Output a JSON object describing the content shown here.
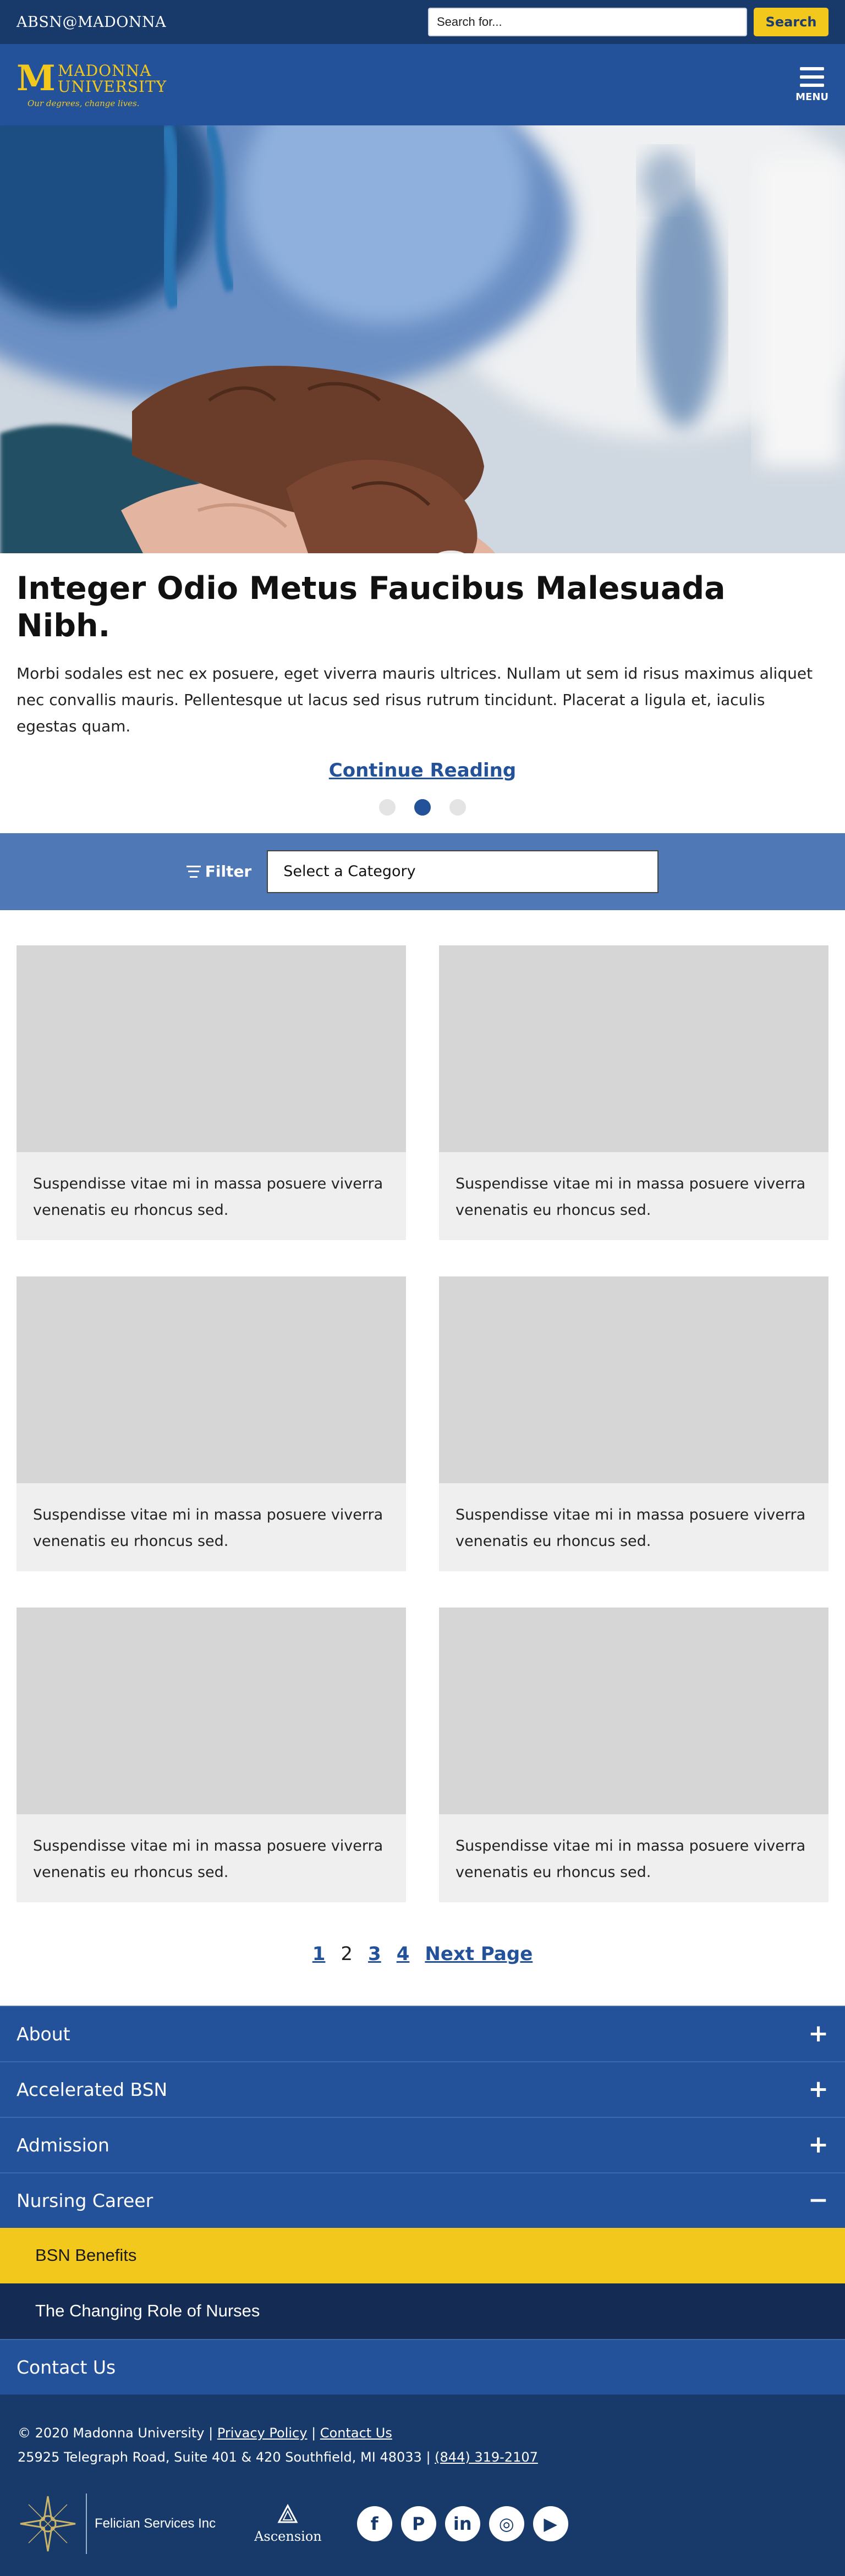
{
  "topbar": {
    "brand": "ABSN@MADONNA",
    "search_placeholder": "Search for...",
    "search_button": "Search"
  },
  "header": {
    "logo_mark": "M",
    "logo_name_line1": "MADONNA",
    "logo_name_line2": "UNIVERSITY",
    "logo_tagline": "Our degrees, change lives.",
    "menu_label": "MENU",
    "menu_icon": "hamburger-icon"
  },
  "hero": {
    "image": "nurse-holding-patient-hands-photo"
  },
  "article": {
    "title": "Integer Odio Metus Faucibus Malesuada Nibh.",
    "body": "Morbi sodales est nec ex posuere, eget viverra mauris ultrices. Nullam ut sem id risus maximus aliquet nec convallis mauris. Pellentesque ut lacus sed risus rutrum tincidunt. Placerat a ligula et, iaculis egestas quam.",
    "continue_label": "Continue Reading",
    "carousel_active_index": 1,
    "carousel_count": 3
  },
  "filter": {
    "label": "Filter",
    "icon": "filter-icon",
    "select_value": "Select a Category"
  },
  "cards": [
    {
      "text": "Suspendisse vitae mi in massa posuere viverra venenatis eu rhoncus sed."
    },
    {
      "text": "Suspendisse vitae mi in massa posuere viverra venenatis eu rhoncus sed."
    },
    {
      "text": "Suspendisse vitae mi in massa posuere viverra venenatis eu rhoncus sed."
    },
    {
      "text": "Suspendisse vitae mi in massa posuere viverra venenatis eu rhoncus sed."
    },
    {
      "text": "Suspendisse vitae mi in massa posuere viverra venenatis eu rhoncus sed."
    },
    {
      "text": "Suspendisse vitae mi in massa posuere viverra venenatis eu rhoncus sed."
    }
  ],
  "pagination": {
    "pages": [
      "1",
      "2",
      "3",
      "4"
    ],
    "current": "2",
    "next_label": "Next Page"
  },
  "footer_nav": {
    "items": [
      {
        "label": "About",
        "icon": "+"
      },
      {
        "label": "Accelerated BSN",
        "icon": "+"
      },
      {
        "label": "Admission",
        "icon": "+"
      },
      {
        "label": "Nursing Career",
        "icon": "−"
      }
    ],
    "sub_items": [
      {
        "label": "BSN Benefits"
      },
      {
        "label": "The Changing Role of Nurses"
      }
    ],
    "contact": {
      "label": "Contact Us"
    }
  },
  "footer": {
    "copyright": "© 2020 Madonna University |",
    "privacy_link": "Privacy Policy",
    "separator": "|",
    "contact_link": "Contact Us",
    "address": "25925 Telegraph Road, Suite 401 & 420 Southfield, MI 48033 |",
    "phone_link": "(844) 319-2107",
    "felician_text": "Felician Services Inc",
    "ascension_text": "Ascension",
    "socials": [
      {
        "name": "facebook-icon",
        "glyph": "f"
      },
      {
        "name": "pinterest-icon",
        "glyph": "P"
      },
      {
        "name": "linkedin-icon",
        "glyph": "in"
      },
      {
        "name": "instagram-icon",
        "glyph": "◎"
      },
      {
        "name": "youtube-icon",
        "glyph": "▶"
      }
    ]
  },
  "colors": {
    "navy": "#173a6b",
    "blue": "#24529a",
    "filter_blue": "#4f78b6",
    "gold": "#f2c81d",
    "dark_navy": "#142b54"
  }
}
